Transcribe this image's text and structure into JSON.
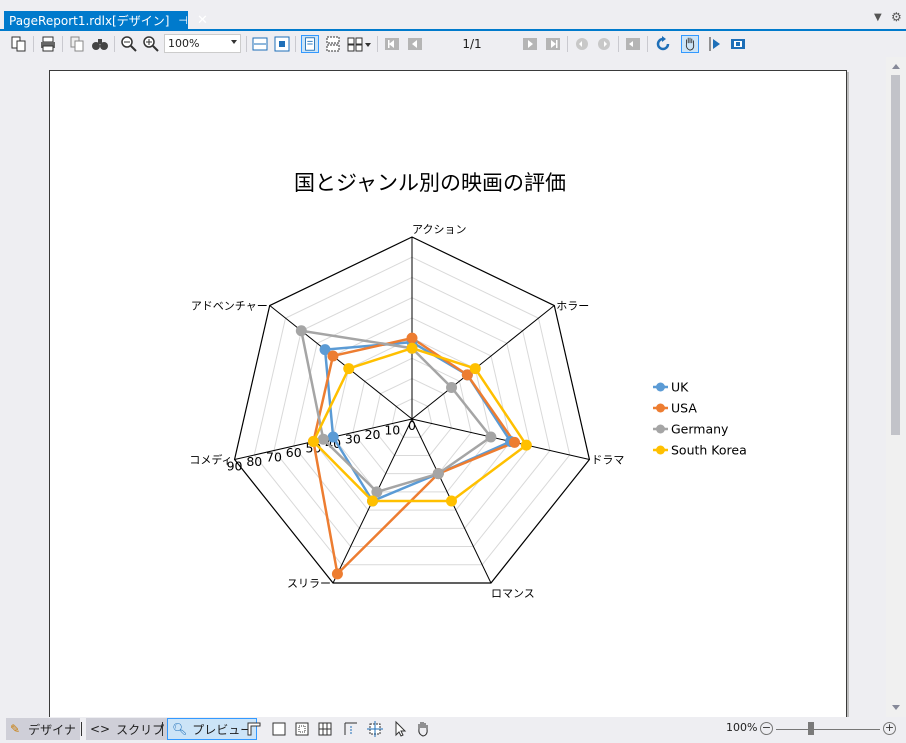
{
  "document_tab": {
    "title": "PageReport1.rdlx[デザイン]",
    "pin": "⊣",
    "close": "✕"
  },
  "toolbar": {
    "zoom_value": "100%",
    "page_indicator": "1/1"
  },
  "status_bar": {
    "design_tab": "デザイナ",
    "script_tab": "スクリプト",
    "preview_tab": "プレビュー",
    "zoom_percent": "100%",
    "zoom_out": "−",
    "zoom_in": "+"
  },
  "colors": {
    "UK": "#5b9bd5",
    "USA": "#ed7d31",
    "Germany": "#a5a5a5",
    "South Korea": "#ffc000",
    "accent": "#007acc"
  },
  "chart_data": {
    "type": "radar",
    "title": "国とジャンル別の映画の評価",
    "categories": [
      "アクション",
      "ホラー",
      "ドラマ",
      "ロマンス",
      "スリラー",
      "コメディ",
      "アドベンチャー"
    ],
    "axis_ticks": [
      "90",
      "80",
      "70",
      "60",
      "50",
      "40",
      "30",
      "20",
      "10",
      "0"
    ],
    "rlim": [
      0,
      90
    ],
    "legend_position": "right",
    "series": [
      {
        "name": "UK",
        "values": [
          38,
          35,
          50,
          30,
          45,
          40,
          55
        ]
      },
      {
        "name": "USA",
        "values": [
          40,
          35,
          52,
          30,
          85,
          50,
          50
        ]
      },
      {
        "name": "Germany",
        "values": [
          35,
          25,
          40,
          30,
          40,
          45,
          70
        ]
      },
      {
        "name": "South Korea",
        "values": [
          35,
          40,
          58,
          45,
          45,
          50,
          40
        ]
      }
    ]
  }
}
